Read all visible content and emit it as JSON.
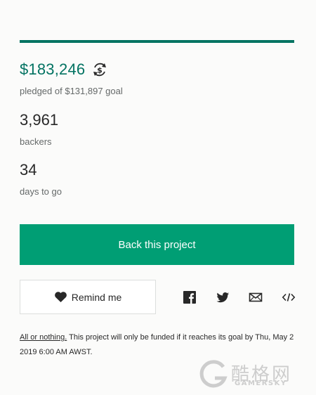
{
  "campaign": {
    "pledged": "$183,246",
    "pledged_label": "pledged of $131,897 goal",
    "funded_fraction": 1.0,
    "backers": "3,961",
    "backers_label": "backers",
    "days": "34",
    "days_label": "days to go"
  },
  "actions": {
    "back_label": "Back this project",
    "remind_label": "Remind me"
  },
  "share_icons": [
    "facebook-icon",
    "twitter-icon",
    "email-icon",
    "embed-icon"
  ],
  "footnote": {
    "link": "All or nothing.",
    "text": " This project will only be funded if it reaches its goal by Thu, May 2 2019 6:00 AM AWST."
  },
  "watermark": {
    "cn": "酷格网",
    "en": "GAMERSKY"
  },
  "colors": {
    "accent": "#037362",
    "button": "#009e74",
    "track": "#dcdedd",
    "muted": "#656969"
  }
}
